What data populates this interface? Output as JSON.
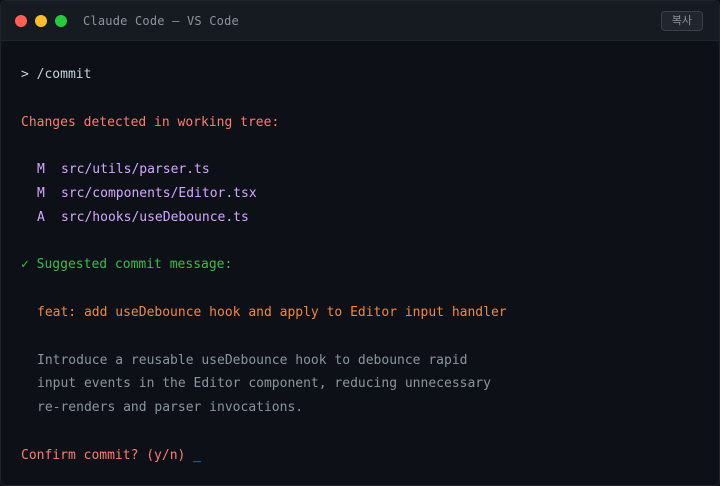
{
  "window": {
    "title": "Claude Code — VS Code",
    "copy_label": "복사"
  },
  "terminal": {
    "prompt_symbol": ">",
    "command": "/commit",
    "changes_header": "Changes detected in working tree:",
    "files": [
      {
        "status": "M",
        "path": "src/utils/parser.ts"
      },
      {
        "status": "M",
        "path": "src/components/Editor.tsx"
      },
      {
        "status": "A",
        "path": "src/hooks/useDebounce.ts"
      }
    ],
    "check_mark": "✓",
    "suggested_header": "Suggested commit message:",
    "commit_subject": "feat: add useDebounce hook and apply to Editor input handler",
    "commit_body": [
      "Introduce a reusable useDebounce hook to debounce rapid",
      "input events in the Editor component, reducing unnecessary",
      "re-renders and parser invocations."
    ],
    "confirm_prompt": "Confirm commit? (y/n)",
    "cursor": "_"
  },
  "colors": {
    "background": "#0d1117",
    "titlebar": "#161b22",
    "header_red": "#ff7b72",
    "path_purple": "#d2a8ff",
    "success_green": "#3fb950",
    "commit_orange": "#f0883e",
    "body_gray": "#8b949e",
    "cursor_blue": "#58a6ff"
  }
}
